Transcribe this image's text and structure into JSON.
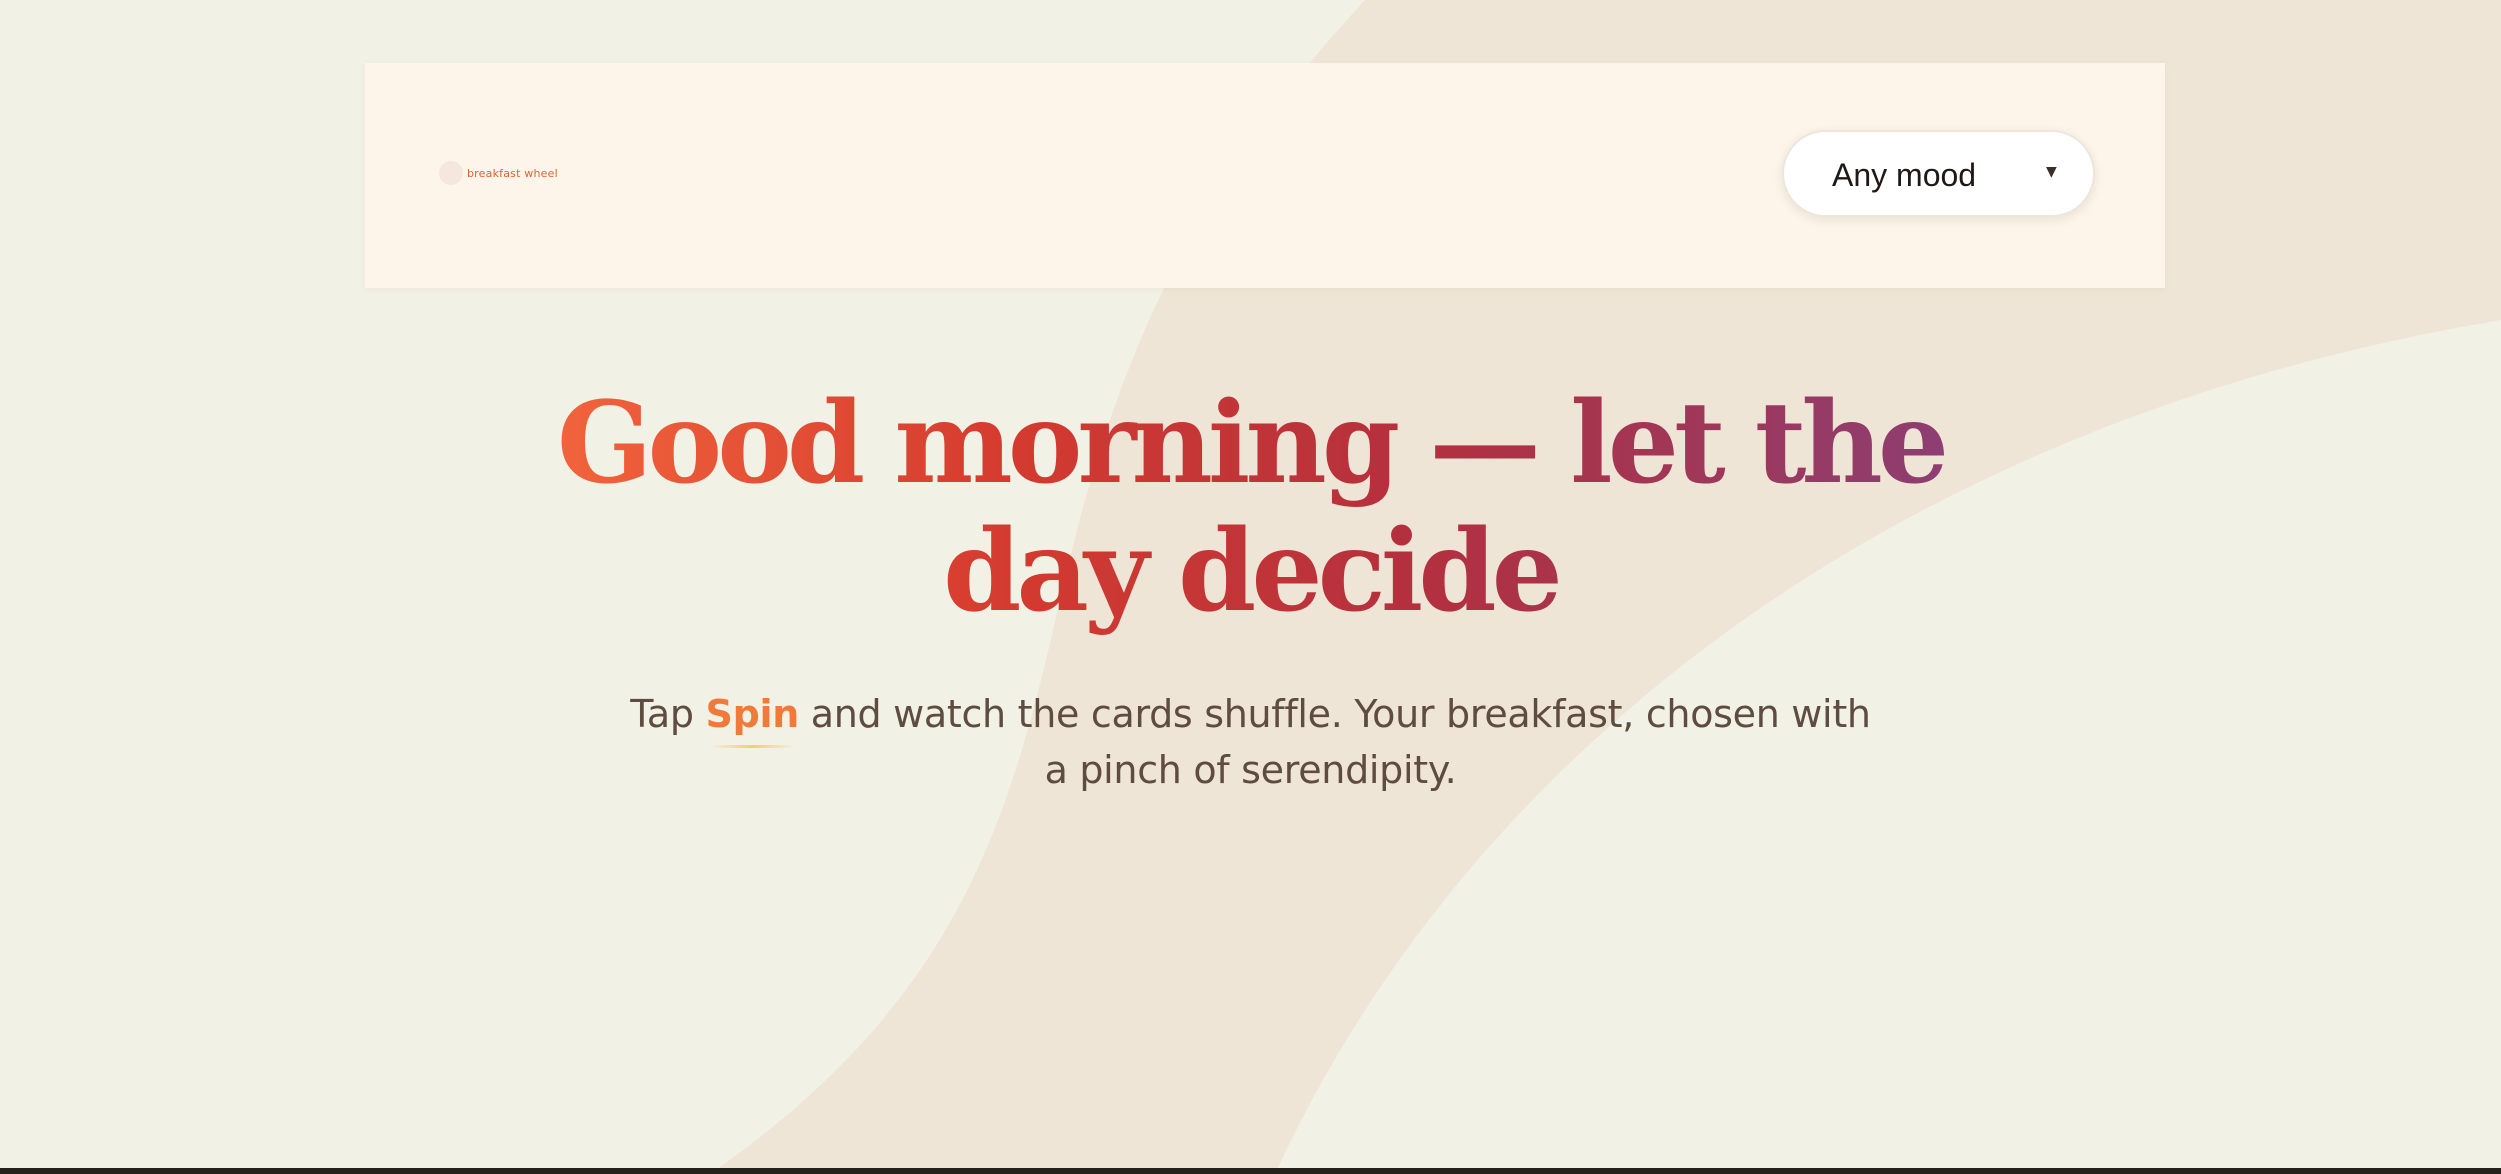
{
  "brand": {
    "name": "breakfast wheel"
  },
  "mood_select": {
    "value": "Any mood",
    "caret_icon": "chevron-down-icon"
  },
  "hero": {
    "headline": "Good morning — let the day decide",
    "subline": {
      "before": "Tap ",
      "highlight": "Spin",
      "after": " and watch the cards shuffle. Your breakfast, chosen with a pinch of serendipity."
    }
  },
  "colors": {
    "page_background": "#f1f1e5",
    "swoosh": "#efe5d6",
    "header_background": "#fdf5ea",
    "brand_accent": "#e0622c",
    "headline_gradient": [
      "#f2643c",
      "#d53b2f",
      "#b3303e",
      "#8d3e72"
    ],
    "subline_text": "#5f4c40",
    "spin_accent": "#f07a3a",
    "spin_underline": "#f4cf6a"
  }
}
